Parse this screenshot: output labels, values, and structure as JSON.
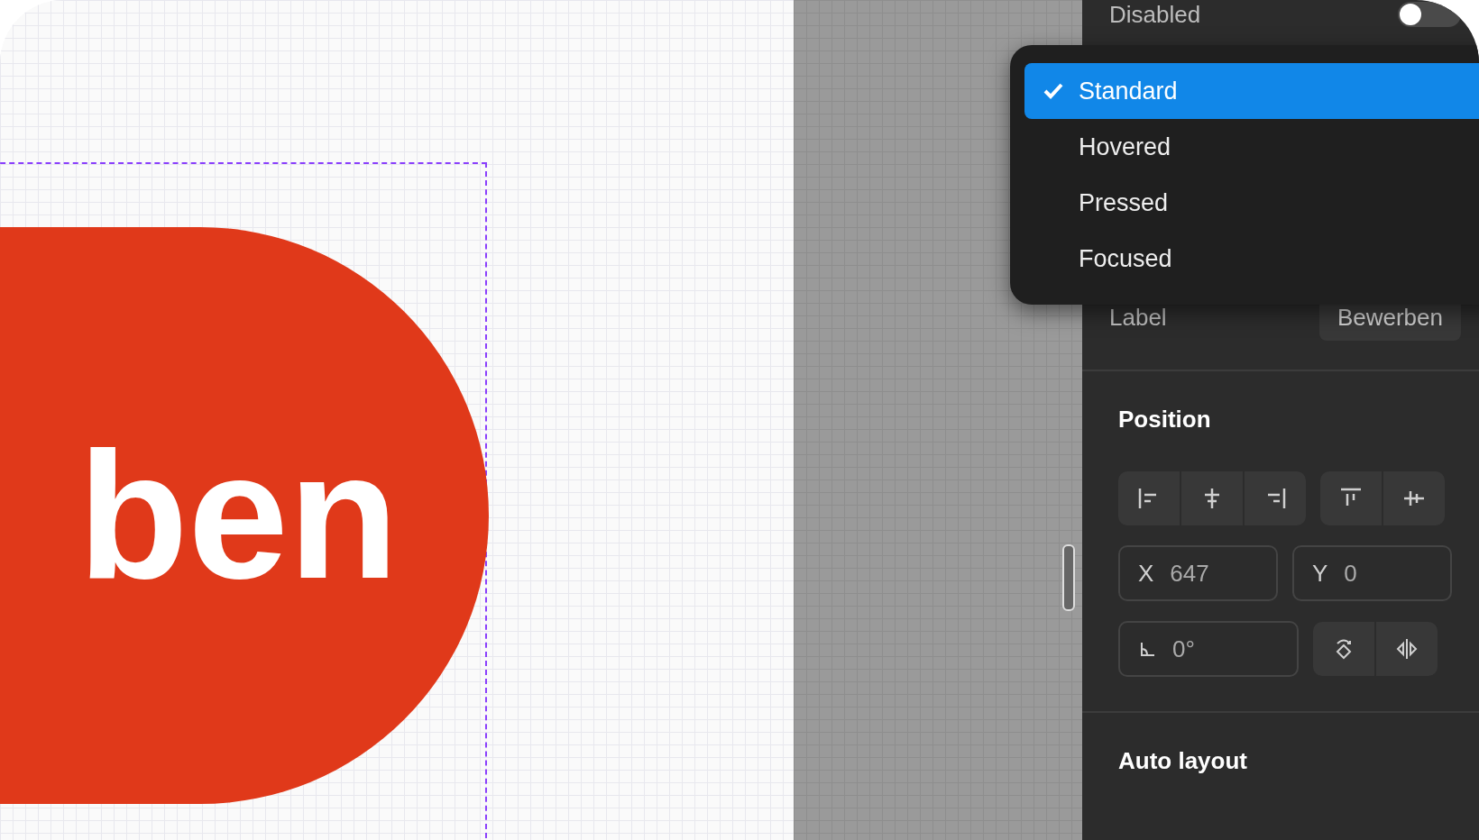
{
  "canvas": {
    "button_text": "ben"
  },
  "properties": {
    "disabled": {
      "label": "Disabled",
      "on": false
    },
    "state_menu": {
      "items": [
        {
          "label": "Standard",
          "selected": true
        },
        {
          "label": "Hovered",
          "selected": false
        },
        {
          "label": "Pressed",
          "selected": false
        },
        {
          "label": "Focused",
          "selected": false
        }
      ]
    },
    "label_row": {
      "label": "Label",
      "value": "Bewerben"
    },
    "position": {
      "title": "Position",
      "x": {
        "label": "X",
        "value": "647"
      },
      "y": {
        "label": "Y",
        "value": "0"
      },
      "rotation": {
        "value": "0°"
      }
    },
    "auto_layout": {
      "title": "Auto layout"
    }
  }
}
